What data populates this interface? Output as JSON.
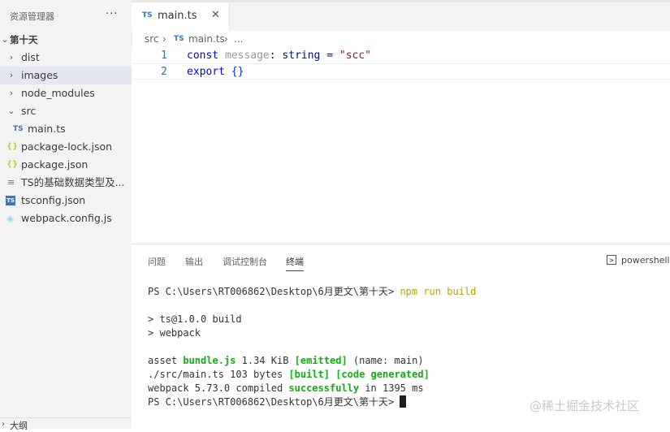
{
  "sidebar": {
    "title": "资源管理器",
    "more_actions": "···",
    "folder": "第十天",
    "items": [
      {
        "label": "dist",
        "kind": "folder",
        "chevron": "›"
      },
      {
        "label": "images",
        "kind": "folder",
        "chevron": "›",
        "selected": true
      },
      {
        "label": "node_modules",
        "kind": "folder",
        "chevron": "›"
      },
      {
        "label": "src",
        "kind": "folder",
        "chevron": "⌄"
      },
      {
        "label": "main.ts",
        "kind": "ts",
        "icon_text": "TS"
      },
      {
        "label": "package-lock.json",
        "kind": "json",
        "icon_text": "{}"
      },
      {
        "label": "package.json",
        "kind": "json",
        "icon_text": "{}"
      },
      {
        "label": "TS的基础数据类型及...",
        "kind": "text",
        "icon_text": "≡"
      },
      {
        "label": "tsconfig.json",
        "kind": "tsconfig",
        "icon_text": "TS"
      },
      {
        "label": "webpack.config.js",
        "kind": "webpack",
        "icon_text": "◈"
      }
    ],
    "outline_label": "大纲"
  },
  "tab": {
    "icon": "TS",
    "label": "main.ts",
    "close": "✕"
  },
  "breadcrumb": {
    "part1": "src",
    "sep": "›",
    "icon": "TS",
    "part2": "main.ts",
    "ellipsis": "..."
  },
  "code": {
    "line_numbers": [
      "1",
      "2"
    ],
    "line1": {
      "kw": "const",
      "var": "message",
      "colon": ":",
      "type": "string",
      "eq": "=",
      "str": "\"scc\""
    },
    "line2": {
      "kw": "export",
      "braces": "{}"
    }
  },
  "panel": {
    "tabs": [
      "问题",
      "输出",
      "调试控制台",
      "终端"
    ],
    "active_tab": "终端",
    "shell_icon": ">",
    "shell_label": "powershell"
  },
  "terminal": {
    "prompt": "PS C:\\Users\\RT006862\\Desktop\\6月更文\\第十天>",
    "command": "npm run build",
    "line_build": "> ts@1.0.0 build",
    "line_webpack": "> webpack",
    "asset_prefix": "asset ",
    "asset_name": "bundle.js",
    "asset_size": " 1.34 KiB ",
    "asset_emitted": "[emitted]",
    "asset_suffix": " (name: main)",
    "src_prefix": "./src/main.ts 103 bytes ",
    "src_built": "[built]",
    "src_generated": "[code generated]",
    "compiled_prefix": "webpack 5.73.0 compiled ",
    "compiled_status": "successfully",
    "compiled_suffix": " in 1395 ms"
  },
  "watermark": "@稀土掘金技术社区",
  "colors": {
    "accent": "#3178c6",
    "json": "#cbcb41",
    "success": "#14ac14",
    "command": "#b5a30a"
  }
}
